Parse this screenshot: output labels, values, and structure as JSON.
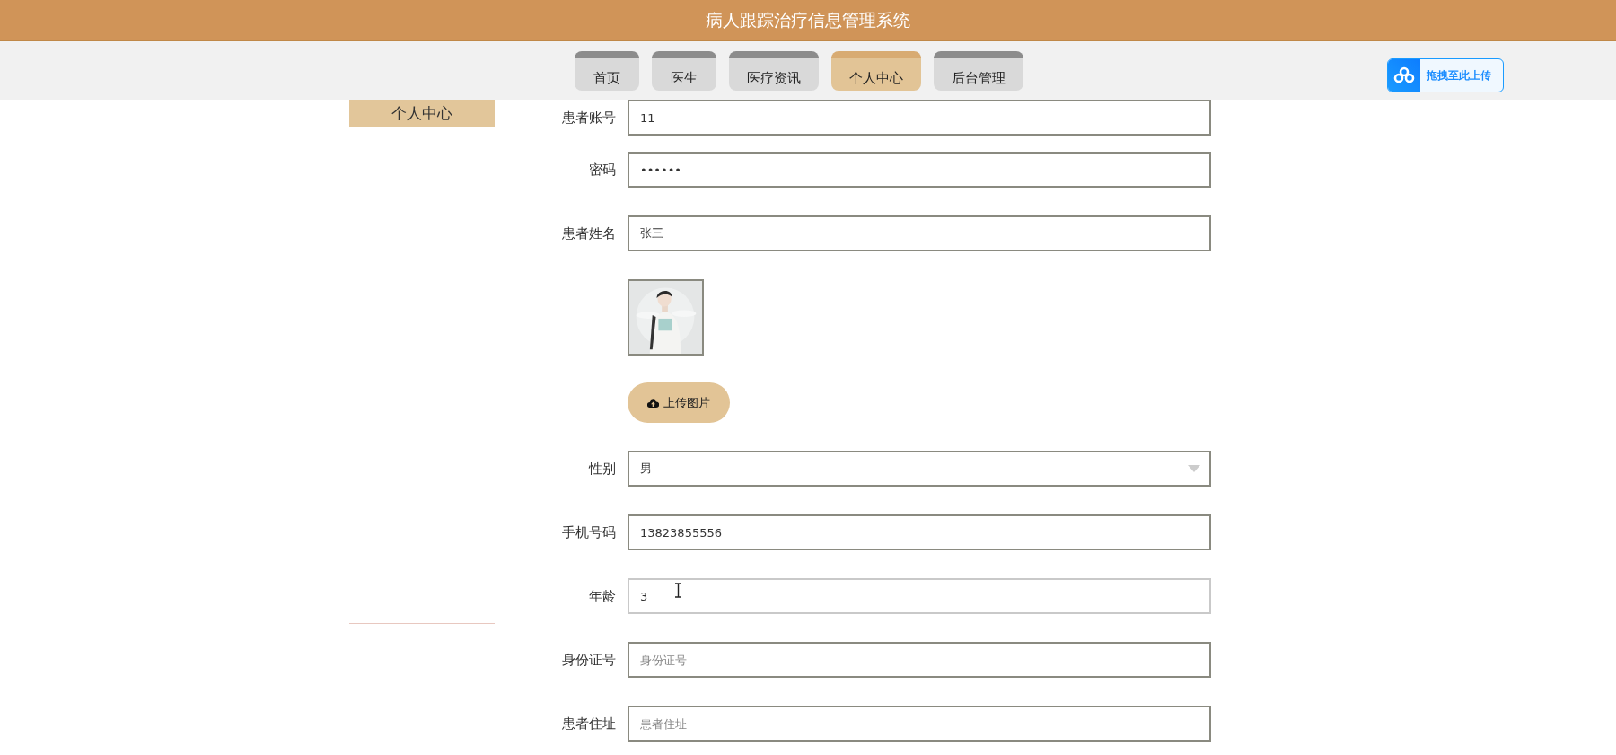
{
  "header": {
    "title": "病人跟踪治疗信息管理系统"
  },
  "nav": {
    "tabs": [
      {
        "label": "首页",
        "selected": false
      },
      {
        "label": "医生",
        "selected": false
      },
      {
        "label": "医疗资讯",
        "selected": false
      },
      {
        "label": "个人中心",
        "selected": true
      },
      {
        "label": "后台管理",
        "selected": false
      }
    ],
    "drop_upload": {
      "label": "拖拽至此上传"
    }
  },
  "sidebar": {
    "items": [
      {
        "label": "个人中心",
        "selected": true
      }
    ]
  },
  "form": {
    "fields": [
      {
        "kind": "input",
        "label": "患者账号",
        "value": "11",
        "focused": false
      },
      {
        "kind": "input",
        "label": "密码",
        "value": "••••••",
        "focused": false
      },
      {
        "kind": "input",
        "label": "患者姓名",
        "value": "张三",
        "focused": false
      },
      {
        "button": "上传图片"
      },
      {
        "kind": "select",
        "label": "性别",
        "value": "男",
        "focused": false
      },
      {
        "kind": "input",
        "label": "手机号码",
        "value": "13823855556",
        "focused": false
      },
      {
        "kind": "input",
        "label": "年龄",
        "value": "3",
        "focused": true
      },
      {
        "kind": "input",
        "label": "身份证号",
        "placeholder": "身份证号",
        "focused": false
      },
      {
        "kind": "input",
        "label": "患者住址",
        "placeholder": "患者住址",
        "focused": false
      }
    ]
  }
}
